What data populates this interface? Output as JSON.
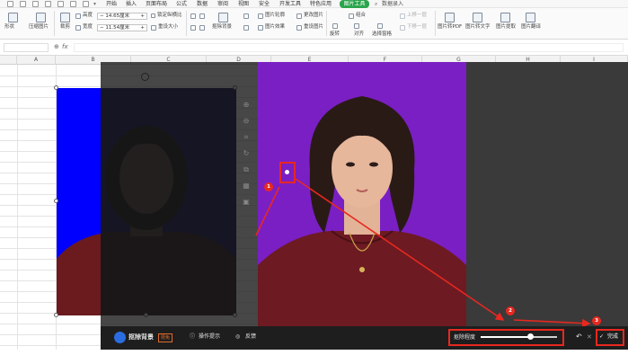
{
  "menubar": {
    "items": [
      "开始",
      "插入",
      "页面布局",
      "公式",
      "数据",
      "审阅",
      "视图",
      "安全",
      "开发工具",
      "特色应用"
    ],
    "active_tab": "图片工具",
    "account": "数据录入"
  },
  "ribbon": {
    "shape_label": "形状",
    "compress_label": "压缩图片",
    "crop_label": "裁剪",
    "height_label": "高度",
    "height_value": "14.65厘米",
    "width_label": "宽度",
    "width_value": "11.54厘米",
    "lock_ratio_label": "锁定纵横比",
    "reset_size_label": "重设大小",
    "remove_bg_label": "抠除背景",
    "outline_label": "图片轮廓",
    "effect_label": "图片效果",
    "change_pic_label": "更改图片",
    "reset_pic_label": "重设图片",
    "combine_label": "组合",
    "rotate_label": "旋转",
    "align_label": "对齐",
    "select_pane_label": "选择窗格",
    "up_layer_label": "上移一层",
    "down_layer_label": "下移一层",
    "to_pdf_label": "图片转PDF",
    "to_text_label": "图片转文字",
    "extract_label": "图片提取",
    "translate_label": "图片翻译"
  },
  "formula_bar": {
    "fx": "fx"
  },
  "columns": [
    "A",
    "B",
    "C",
    "D",
    "E",
    "F",
    "G",
    "H",
    "I"
  ],
  "bottom_bar": {
    "title": "抠除背景",
    "badge": "限免",
    "hint_label": "操作提示",
    "feedback_label": "反馈",
    "degree_label": "抠除程度",
    "done_label": "完成"
  },
  "slider": {
    "value": 0.65
  },
  "annotations": {
    "one": "1",
    "two": "2",
    "three": "3"
  },
  "colors": {
    "accent_green": "#2aa54c",
    "purple_bg": "#7a1fc4",
    "blue_bg": "#0000ff",
    "annotation_red": "#e8281f"
  }
}
